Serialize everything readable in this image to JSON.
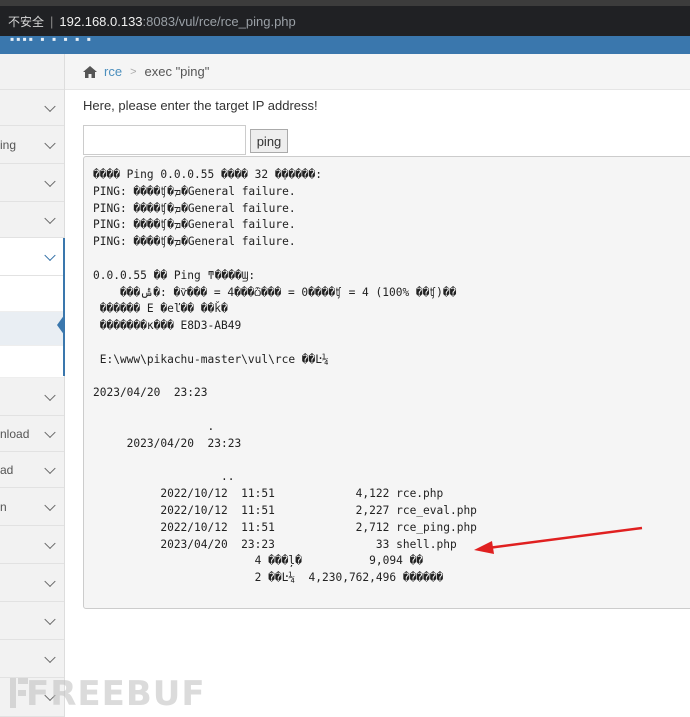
{
  "browser": {
    "insecure_label": "不安全",
    "host": "192.168.0.133",
    "path": ":8083/vul/rce/rce_ping.php"
  },
  "sidebar": {
    "items": [
      {
        "label": ""
      },
      {
        "label": "ing"
      },
      {
        "label": ""
      },
      {
        "label": ""
      },
      {
        "label": ""
      },
      {
        "label": "nload"
      },
      {
        "label": "ad"
      },
      {
        "label": "n"
      },
      {
        "label": ""
      },
      {
        "label": ""
      },
      {
        "label": ""
      },
      {
        "label": ""
      }
    ]
  },
  "breadcrumb": {
    "home_icon": "home-icon",
    "link": "rce",
    "current": "exec \"ping\""
  },
  "form": {
    "prompt": "Here, please enter the target IP address!",
    "input_value": "",
    "button_label": "ping"
  },
  "output": {
    "text": "���� Ping 0.0.0.55 ���� 32 �ֽ�����:\nPING: ����ʧ�ܡ�General failure.\nPING: ����ʧ�ܡ�General failure.\nPING: ����ʧ�ܡ�General failure.\nPING: ����ʧ�ܡ�General failure.\n\n0.0.0.55 �� Ping ͳ����Ϣ:\n    ���ݰ�: �ѷ��� = 4���ѽ��� = 0����ʧ = 4 (100% ��ʧ)��\n ������ E �еľ�� ��ǩ�\n �������к��� E8D3-AB49\n\n E:\\www\\pikachu-master\\vul\\rce ��Ŀ¼\n\n2023/04/20  23:23\n\n                 .\n     2023/04/20  23:23\n\n                   ..\n          2022/10/12  11:51            4,122 rce.php\n          2022/10/12  11:51            2,227 rce_eval.php\n          2022/10/12  11:51            2,712 rce_ping.php\n          2023/04/20  23:23               33 shell.php\n                        4 ���ļ�          9,094 ��\n                        2 ��Ŀ¼  4,230,762,496 ������"
  },
  "watermark": {
    "text": "FREEBUF"
  }
}
